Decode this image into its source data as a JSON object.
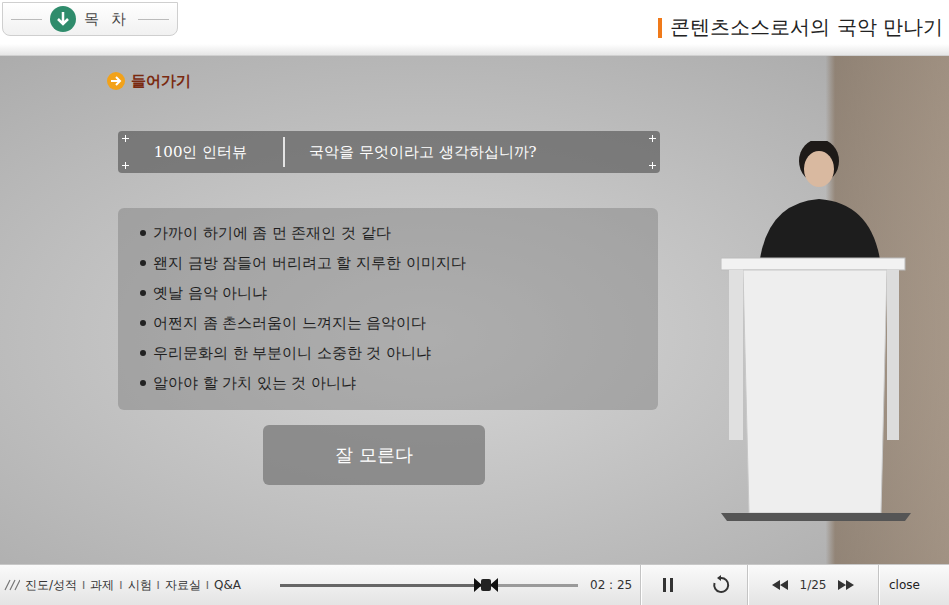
{
  "header": {
    "toc_label": "목 차",
    "title": "콘텐츠소스로서의 국악 만나기"
  },
  "intro": {
    "label": "들어가기"
  },
  "banner": {
    "tag": "100인 인터뷰",
    "question": "국악을 무엇이라고 생각하십니까?"
  },
  "answers": [
    "가까이 하기에 좀 먼 존재인 것 같다",
    "왠지 금방 잠들어 버리려고 할 지루한 이미지다",
    "옛날 음악 아니냐",
    "어쩐지 좀 촌스러움이 느껴지는 음악이다",
    "우리문화의 한 부분이니 소중한 것 아니냐",
    "알아야 할 가치 있는 것 아니냐"
  ],
  "answer_button": "잘 모른다",
  "footer": {
    "links": [
      "진도/성적",
      "과제",
      "시험",
      "자료실",
      "Q&A"
    ],
    "separator": "I",
    "player": {
      "level": 0.69,
      "time": "02 : 25",
      "playing": true,
      "page": "1/25",
      "close": "close"
    }
  }
}
